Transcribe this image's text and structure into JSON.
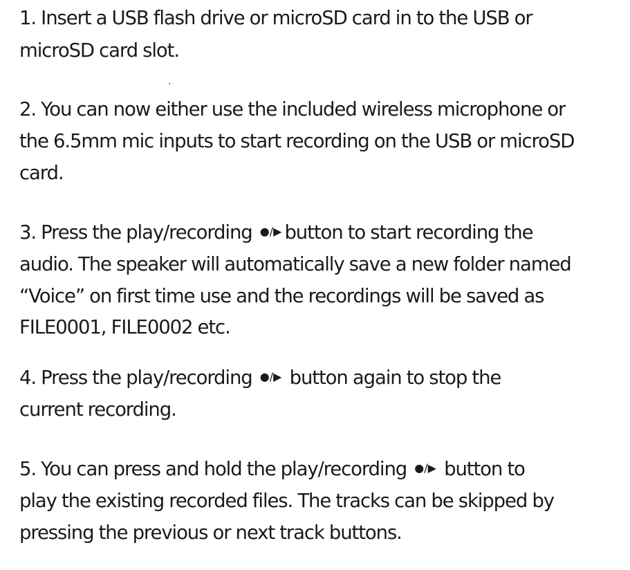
{
  "steps": [
    {
      "lines": [
        "1. Insert a USB flash drive or microSD card in to the USB or",
        " microSD card slot."
      ]
    },
    {
      "lines": [
        "2. You can now either use the included wireless microphone or",
        "the 6.5mm mic inputs to start recording on the USB or microSD",
        "card."
      ]
    },
    {
      "line1_before": "3. Press the play/recording",
      "line1_after": "button to start recording the",
      "lines": [
        "audio. The speaker will automatically save a new folder named",
        "“Voice” on first time use and the recordings will be saved as",
        "FILE0001, FILE0002 etc."
      ]
    },
    {
      "line1_before": "4. Press the play/recording",
      "line1_after": " button again to stop the",
      "lines": [
        "current  recording."
      ]
    },
    {
      "line1_before": "5. You can press and hold the play/recording",
      "line1_after": " button to",
      "lines": [
        "play the existing recorded files. The tracks can be skipped by",
        "pressing the previous or next track buttons."
      ]
    }
  ],
  "icons": {
    "record_play": "●/▶"
  }
}
